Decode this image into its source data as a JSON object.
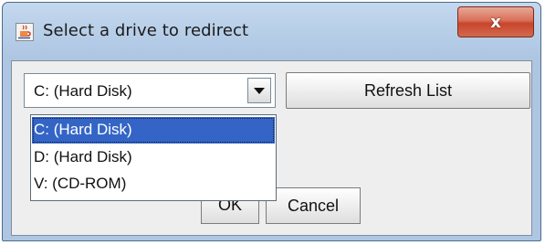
{
  "window": {
    "title": "Select a drive to redirect",
    "icon": "java-coffee-icon",
    "close_label": "x"
  },
  "drive_select": {
    "selected_value": "C: (Hard Disk)",
    "options": [
      "C: (Hard Disk)",
      "D: (Hard Disk)",
      "V: (CD-ROM)"
    ],
    "selected_index": 0
  },
  "buttons": {
    "refresh": "Refresh List",
    "ok": "OK",
    "cancel": "Cancel"
  },
  "colors": {
    "selection": "#3465c6",
    "close_button": "#c8452c"
  }
}
